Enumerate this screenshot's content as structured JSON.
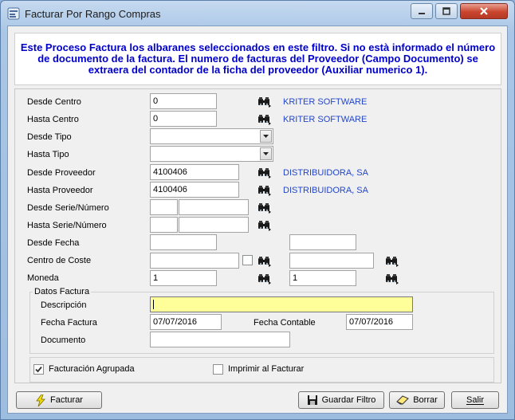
{
  "window": {
    "title": "Facturar Por Rango Compras"
  },
  "header": {
    "text": "Este Proceso Factura los albaranes seleccionados en este filtro. Si no està informado el número de documento de la factura. El numero de facturas del Proveedor (Campo Documento) se extraera del contador de la ficha del proveedor (Auxiliar numerico 1)."
  },
  "filters": {
    "desde_centro": {
      "label": "Desde Centro",
      "value": "0",
      "link": "KRITER SOFTWARE"
    },
    "hasta_centro": {
      "label": "Hasta Centro",
      "value": "0",
      "link": "KRITER SOFTWARE"
    },
    "desde_tipo": {
      "label": "Desde Tipo",
      "value": ""
    },
    "hasta_tipo": {
      "label": "Hasta Tipo",
      "value": ""
    },
    "desde_proveedor": {
      "label": "Desde Proveedor",
      "value": "4100406",
      "link": "DISTRIBUIDORA, SA"
    },
    "hasta_proveedor": {
      "label": "Hasta Proveedor",
      "value": "4100406",
      "link": "DISTRIBUIDORA, SA"
    },
    "desde_serie": {
      "label": "Desde Serie/Número",
      "serie": "",
      "numero": ""
    },
    "hasta_serie": {
      "label": "Hasta Serie/Número",
      "serie": "",
      "numero": ""
    },
    "desde_fecha": {
      "label": "Desde Fecha",
      "value": "",
      "value2": ""
    },
    "centro_coste": {
      "label": "Centro de Coste",
      "value": "",
      "value2": "",
      "checked": false
    },
    "moneda": {
      "label": "Moneda",
      "value": "1",
      "value2": "1"
    }
  },
  "datos_factura": {
    "title": "Datos Factura",
    "descripcion": {
      "label": "Descripción",
      "value": ""
    },
    "fecha_factura": {
      "label": "Fecha Factura",
      "value": "07/07/2016"
    },
    "fecha_contable": {
      "label": "Fecha Contable",
      "value": "07/07/2016"
    },
    "documento": {
      "label": "Documento",
      "value": ""
    }
  },
  "options": {
    "agrupada": {
      "label": "Facturación Agrupada",
      "checked": true
    },
    "imprimir": {
      "label": "Imprimir al Facturar",
      "checked": false
    }
  },
  "buttons": {
    "facturar": "Facturar",
    "guardar": "Guardar Filtro",
    "borrar": "Borrar",
    "salir": "Salir"
  },
  "colors": {
    "header_text": "#0000cc",
    "link": "#2346c8",
    "highlight": "#ffff99",
    "close_button": "#c9452e"
  }
}
